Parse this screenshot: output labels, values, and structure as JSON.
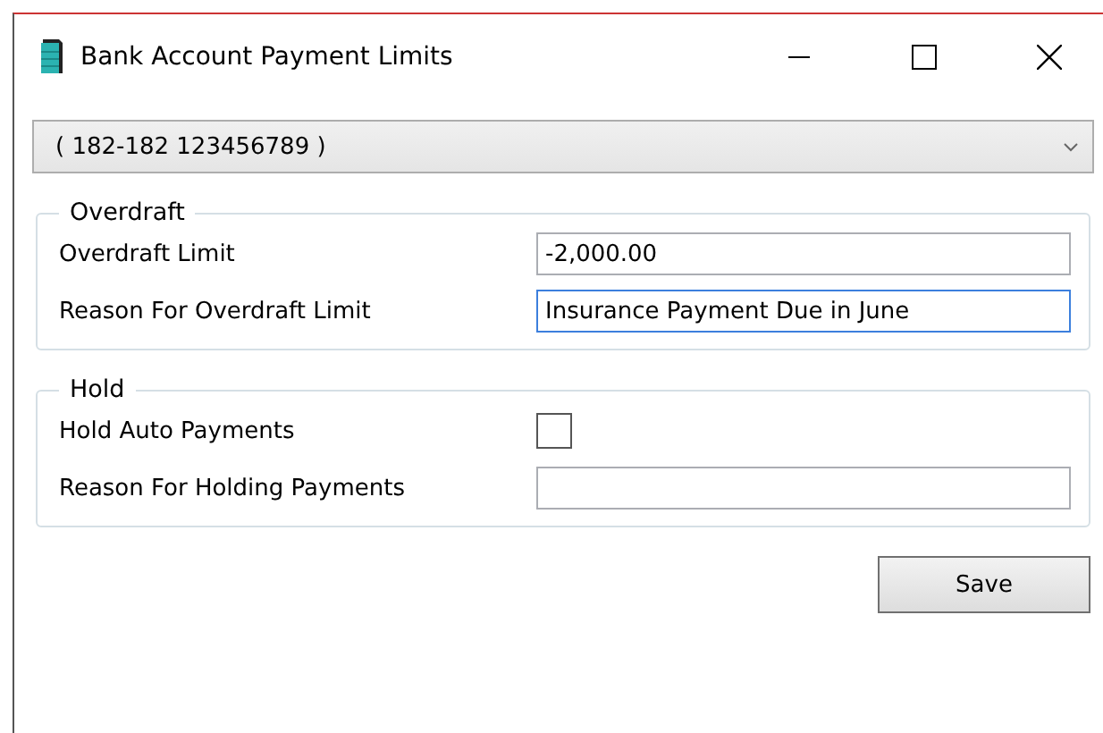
{
  "window": {
    "title": "Bank Account Payment Limits"
  },
  "account_dropdown": {
    "value": "( 182-182 123456789 )"
  },
  "groups": [
    {
      "title": "Overdraft",
      "rows": [
        {
          "kind": "text",
          "label": "Overdraft Limit",
          "value": "-2,000.00",
          "focused": false
        },
        {
          "kind": "text",
          "label": "Reason For Overdraft Limit",
          "value": "Insurance Payment Due in June",
          "focused": true
        }
      ]
    },
    {
      "title": "Hold",
      "rows": [
        {
          "kind": "checkbox",
          "label": "Hold Auto Payments",
          "checked": false
        },
        {
          "kind": "text",
          "label": "Reason For Holding Payments",
          "focused": false
        }
      ]
    }
  ],
  "buttons": [
    "Save"
  ]
}
